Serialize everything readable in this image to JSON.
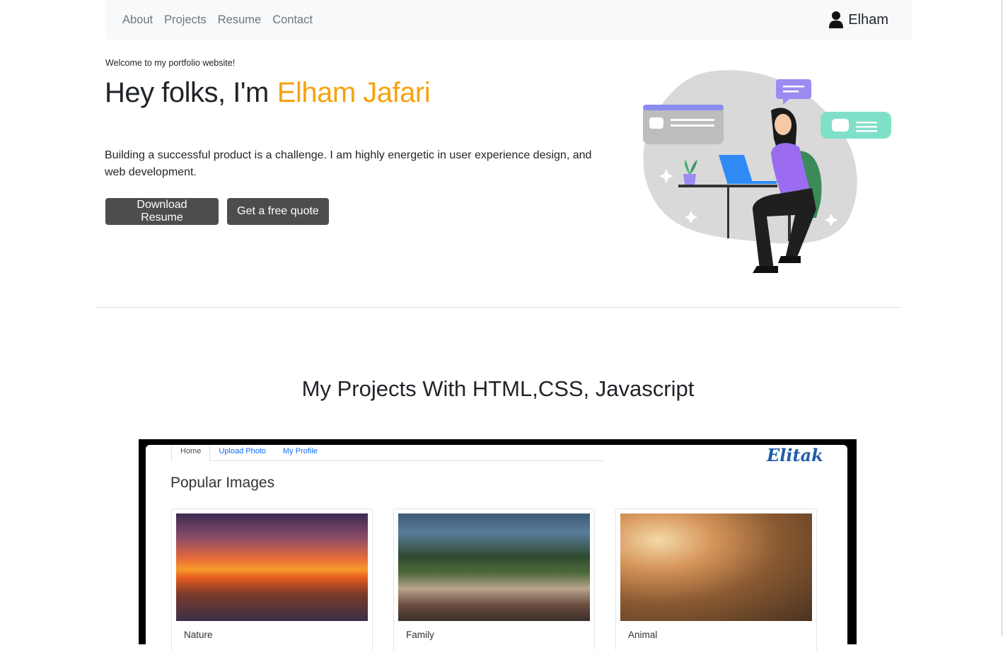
{
  "nav": {
    "links": [
      "About",
      "Projects",
      "Resume",
      "Contact"
    ],
    "user_name": "Elham",
    "user_icon": "user-icon"
  },
  "hero": {
    "welcome": "Welcome to my portfolio website!",
    "title_prefix": "Hey folks, I'm",
    "title_name": "Elham Jafari",
    "description": "Building a successful product is a challenge. I am highly energetic in user experience design, and web development.",
    "buttons": {
      "download_resume": "Download Resume",
      "free_quote": "Get a free quote"
    }
  },
  "projects": {
    "title": "My Projects With HTML,CSS, Javascript",
    "preview": {
      "tabs": [
        "Home",
        "Upload Photo",
        "My Profile"
      ],
      "logo": "Elitak",
      "heading": "Popular Images",
      "cards": [
        {
          "caption": "Nature"
        },
        {
          "caption": "Family"
        },
        {
          "caption": "Animal"
        }
      ]
    }
  },
  "colors": {
    "accent": "#f6a20d",
    "button_bg": "#4d4d4d",
    "navbar_bg": "#f8f9fa",
    "link_blue": "#0d6efd"
  }
}
